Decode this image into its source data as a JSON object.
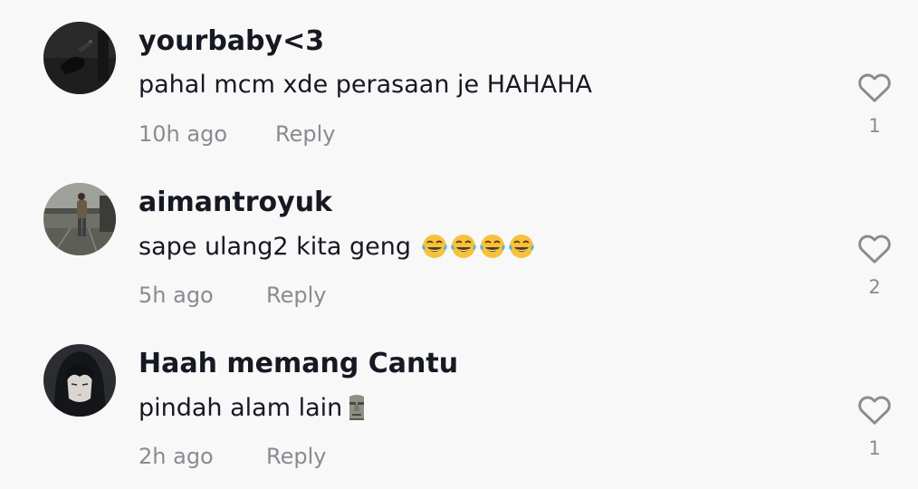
{
  "comments": [
    {
      "username": "yourbaby<3",
      "text": "pahal mcm xde perasaan je HAHAHA",
      "emoji": "",
      "time": "10h ago",
      "reply_label": "Reply",
      "likes": "1",
      "avatar_icon": "avatar-dark-hand"
    },
    {
      "username": "aimantroyuk",
      "text": "sape ulang2 kita geng",
      "emoji": "😂😂😂😂",
      "time": "5h ago",
      "reply_label": "Reply",
      "likes": "2",
      "avatar_icon": "avatar-person-parking"
    },
    {
      "username": "Haah memang Cantu",
      "text": "pindah alam lain",
      "emoji": "🗿",
      "time": "2h ago",
      "reply_label": "Reply",
      "likes": "1",
      "avatar_icon": "avatar-anime-hood"
    }
  ],
  "icons": {
    "like": "heart-outline-icon"
  },
  "colors": {
    "background": "#f8f8f8",
    "username": "#161823",
    "secondary": "#8a8b91"
  }
}
